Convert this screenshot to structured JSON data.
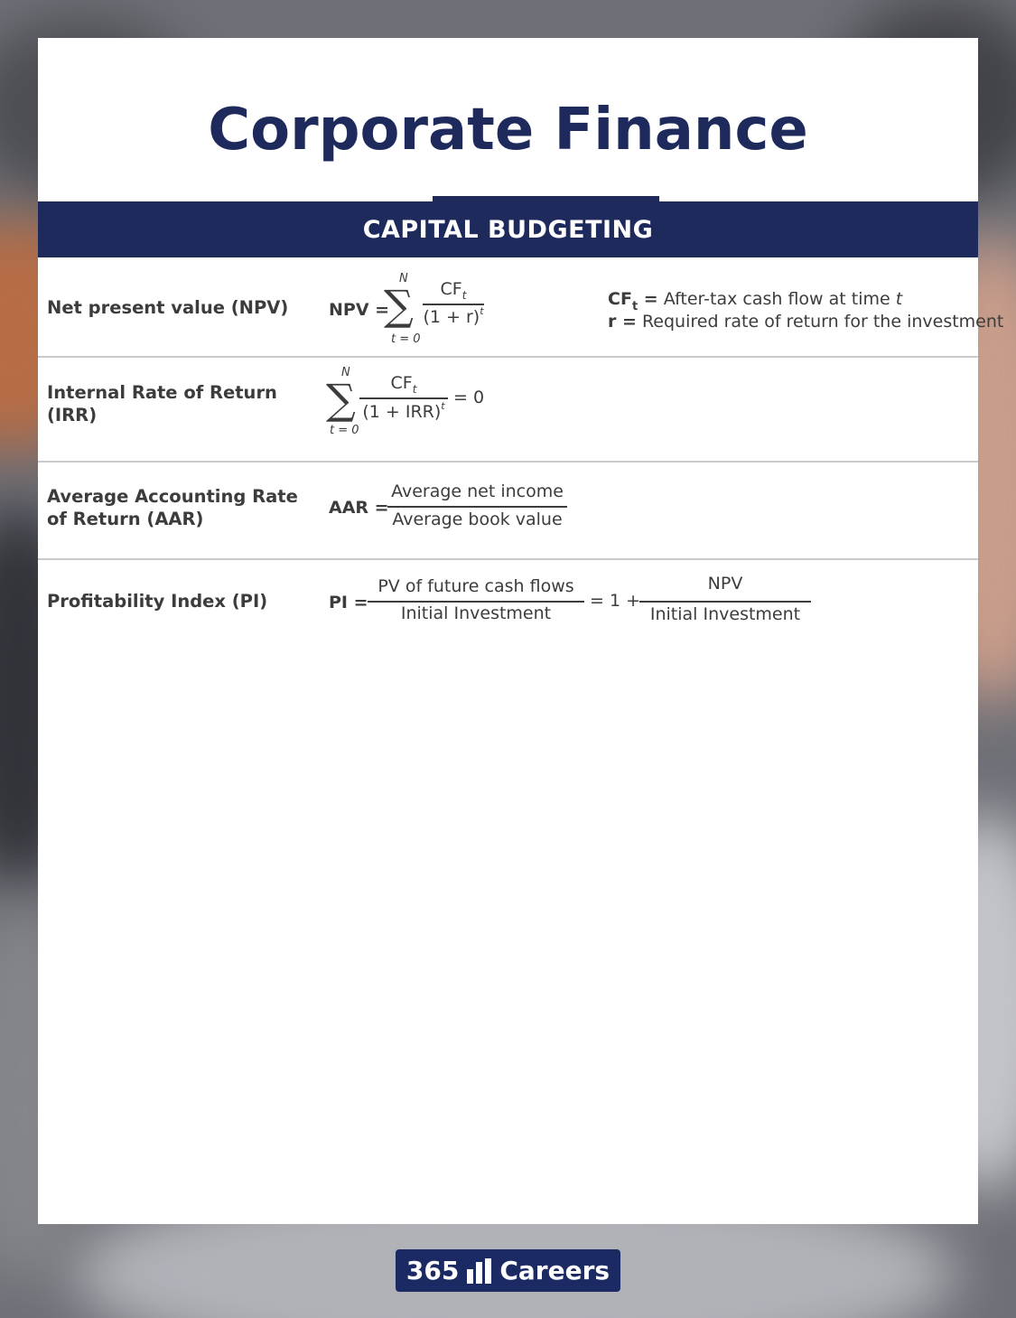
{
  "title": "Corporate Finance",
  "section": "CAPITAL BUDGETING",
  "rows": [
    {
      "label": "Net present value (NPV)",
      "lhs": "NPV =",
      "sum_upper": "N",
      "sum_lower": "t = 0",
      "num": "CF",
      "num_sub": "t",
      "den": "(1 + r)",
      "den_sup": "t",
      "notes": [
        {
          "term": "CF",
          "term_sub": "t",
          "eq": " =",
          "text": " After-tax cash flow at time ",
          "var": "t"
        },
        {
          "term": "r",
          "eq": " =",
          "text": " Required rate of return for the investment"
        }
      ]
    },
    {
      "label": "Internal Rate of Return (IRR)",
      "sum_upper": "N",
      "sum_lower": "t = 0",
      "num": "CF",
      "num_sub": "t",
      "den": "(1 + IRR)",
      "den_sup": "t",
      "rhs": "= 0"
    },
    {
      "label": "Average Accounting Rate of Return (AAR)",
      "lhs": "AAR =",
      "num": "Average net income",
      "den": "Average book value"
    },
    {
      "label": "Profitability Index (PI)",
      "lhs": "PI =",
      "num1": "PV of future cash flows",
      "den1": "Initial Investment",
      "mid": "= 1 +",
      "num2": "NPV",
      "den2": "Initial Investment"
    }
  ],
  "logo": {
    "left": "365",
    "right": "Careers",
    "icon": "bar-chart-icon"
  },
  "colors": {
    "navy": "#1f2a5c",
    "logo_bg": "#1b2a63",
    "text": "#3c3c3c",
    "divider": "#c9cacd"
  }
}
